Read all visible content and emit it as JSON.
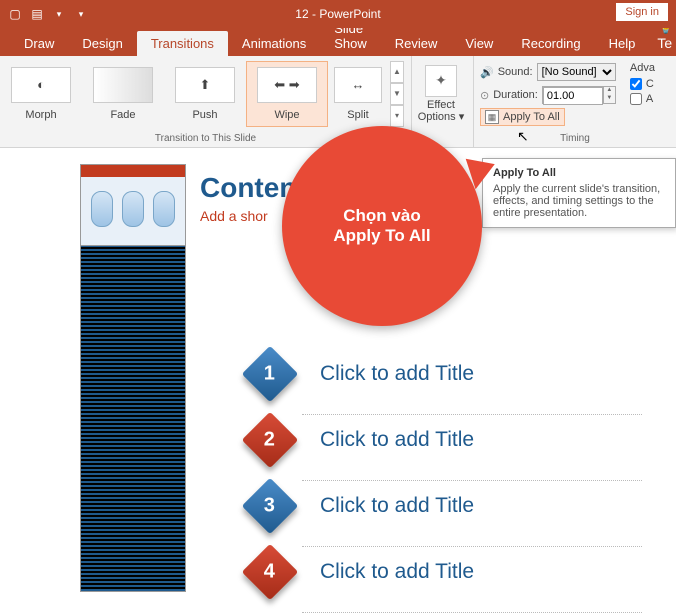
{
  "titlebar": {
    "title": "12 - PowerPoint",
    "signin": "Sign in"
  },
  "tabs": [
    "Draw",
    "Design",
    "Transitions",
    "Animations",
    "Slide Show",
    "Review",
    "View",
    "Recording",
    "Help"
  ],
  "active_tab": "Transitions",
  "ribbon": {
    "transitions_group_label": "Transition to This Slide",
    "timing_group_label": "Timing",
    "transitions": [
      {
        "label": "Morph"
      },
      {
        "label": "Fade"
      },
      {
        "label": "Push"
      },
      {
        "label": "Wipe",
        "selected": true
      },
      {
        "label": "Split"
      }
    ],
    "effect_options": "Effect Options",
    "sound_label": "Sound:",
    "sound_value": "[No Sound]",
    "duration_label": "Duration:",
    "duration_value": "01.00",
    "apply_all": "Apply To All",
    "advance_label": "Adva",
    "chk_onclick": true,
    "chk_onclick_label": "C",
    "chk_after": false,
    "chk_after_label": "A"
  },
  "tooltip": {
    "title": "Apply To All",
    "body": "Apply the current slide's transition, effects, and timing settings to the entire presentation."
  },
  "callout": {
    "line1": "Chọn vào",
    "line2": "Apply To All"
  },
  "slide": {
    "title": "Conten",
    "subtitle": "Add a shor",
    "items": [
      {
        "num": "1",
        "label": "Click to add Title",
        "color": "blue"
      },
      {
        "num": "2",
        "label": "Click to add Title",
        "color": "red"
      },
      {
        "num": "3",
        "label": "Click to add Title",
        "color": "blue"
      },
      {
        "num": "4",
        "label": "Click to add Title",
        "color": "red"
      }
    ]
  }
}
